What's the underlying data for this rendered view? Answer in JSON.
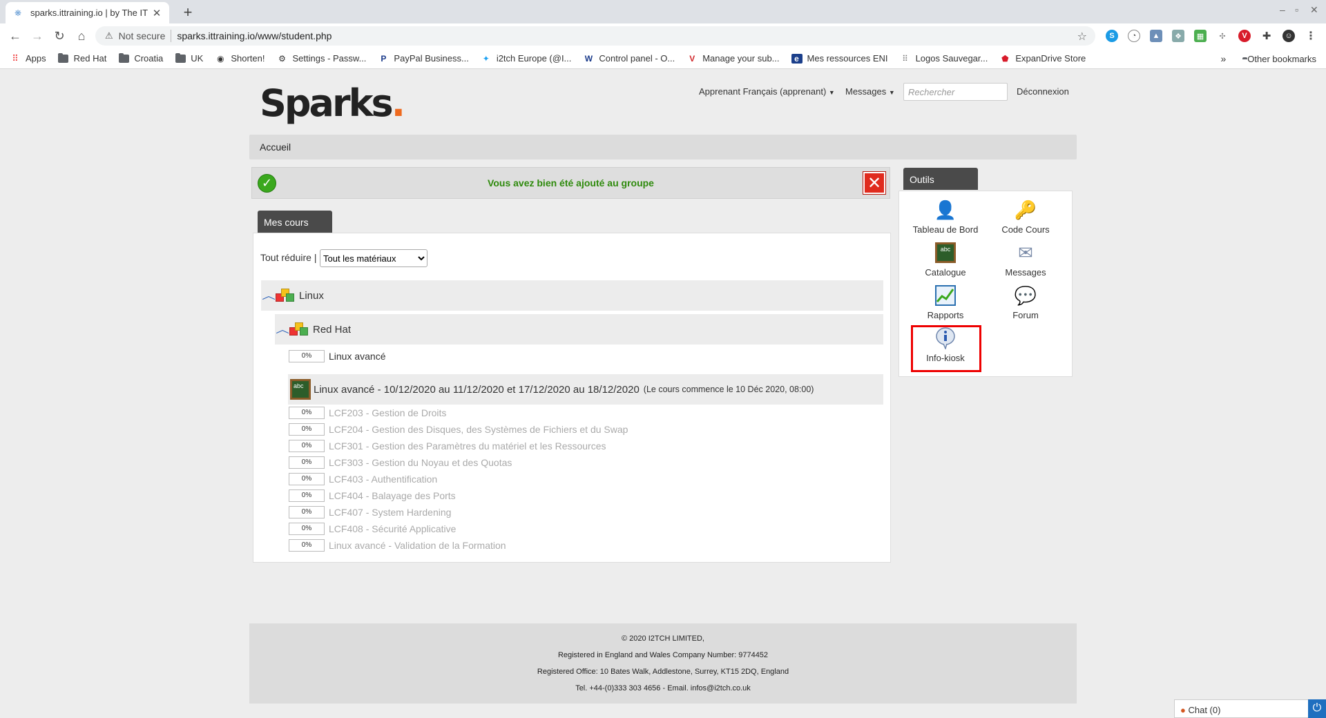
{
  "browser": {
    "tab_title": "sparks.ittraining.io | by The IT",
    "security_label": "Not secure",
    "url": "sparks.ittraining.io/www/student.php",
    "bookmarks": [
      "Apps",
      "Red Hat",
      "Croatia",
      "UK",
      "Shorten!",
      "Settings - Passw...",
      "PayPal Business...",
      "i2tch Europe (@I...",
      "Control panel - O...",
      "Manage your sub...",
      "Mes ressources ENI",
      "Logos Sauvegar...",
      "ExpanDrive Store"
    ],
    "more_bookmarks": "»",
    "other_bookmarks": "Other bookmarks"
  },
  "header": {
    "logo": "Sparks",
    "logo_dot": ".",
    "user_menu": "Apprenant Français (apprenant)",
    "messages_menu": "Messages",
    "search_placeholder": "Rechercher",
    "logout": "Déconnexion"
  },
  "breadcrumb": "Accueil",
  "alert": {
    "message": "Vous avez bien été ajouté au groupe"
  },
  "courses": {
    "tab_label": "Mes cours",
    "collapse_all": "Tout réduire",
    "separator": "|",
    "filter_options": [
      "Tout les matériaux"
    ],
    "filter_value": "Tout les matériaux",
    "category": "Linux",
    "subcategory": "Red Hat",
    "subcategory_item": {
      "progress": "0%",
      "label": "Linux avancé"
    },
    "course_title": "Linux avancé - 10/12/2020 au 11/12/2020 et 17/12/2020 au 18/12/2020",
    "course_note": "(Le cours commence le 10 Déc 2020, 08:00)",
    "lessons": [
      {
        "progress": "0%",
        "label": "LCF203 - Gestion de Droits"
      },
      {
        "progress": "0%",
        "label": "LCF204 - Gestion des Disques, des Systèmes de Fichiers et du Swap"
      },
      {
        "progress": "0%",
        "label": "LCF301 - Gestion des Paramètres du matériel et les Ressources"
      },
      {
        "progress": "0%",
        "label": "LCF303 - Gestion du Noyau et des Quotas"
      },
      {
        "progress": "0%",
        "label": "LCF403 - Authentification"
      },
      {
        "progress": "0%",
        "label": "LCF404 - Balayage des Ports"
      },
      {
        "progress": "0%",
        "label": "LCF407 - System Hardening"
      },
      {
        "progress": "0%",
        "label": "LCF408 - Sécurité Applicative"
      },
      {
        "progress": "0%",
        "label": "Linux avancé - Validation de la Formation"
      }
    ]
  },
  "tools": {
    "tab_label": "Outils",
    "items": [
      {
        "label": "Tableau de Bord",
        "icon": "user-icon"
      },
      {
        "label": "Code Cours",
        "icon": "key-icon"
      },
      {
        "label": "Catalogue",
        "icon": "chalkboard-icon"
      },
      {
        "label": "Messages",
        "icon": "envelope-icon"
      },
      {
        "label": "Rapports",
        "icon": "chart-icon"
      },
      {
        "label": "Forum",
        "icon": "speech-bubbles-icon"
      },
      {
        "label": "Info-kiosk",
        "icon": "info-icon"
      }
    ]
  },
  "footer": {
    "line1": "© 2020 I2TCH LIMITED,",
    "line2": "Registered in England and Wales Company Number: 9774452",
    "line3": "Registered Office: 10 Bates Walk, Addlestone, Surrey, KT15 2DQ, England",
    "line4": "Tel. +44-(0)333 303 4656 - Email. infos@i2tch.co.uk"
  },
  "chat": {
    "label": "Chat (0)"
  },
  "colors": {
    "accent_orange": "#ee6a1f",
    "success_green": "#2e8a0c",
    "tab_dark": "#4a4a4a",
    "highlight_red": "#ee0000"
  }
}
